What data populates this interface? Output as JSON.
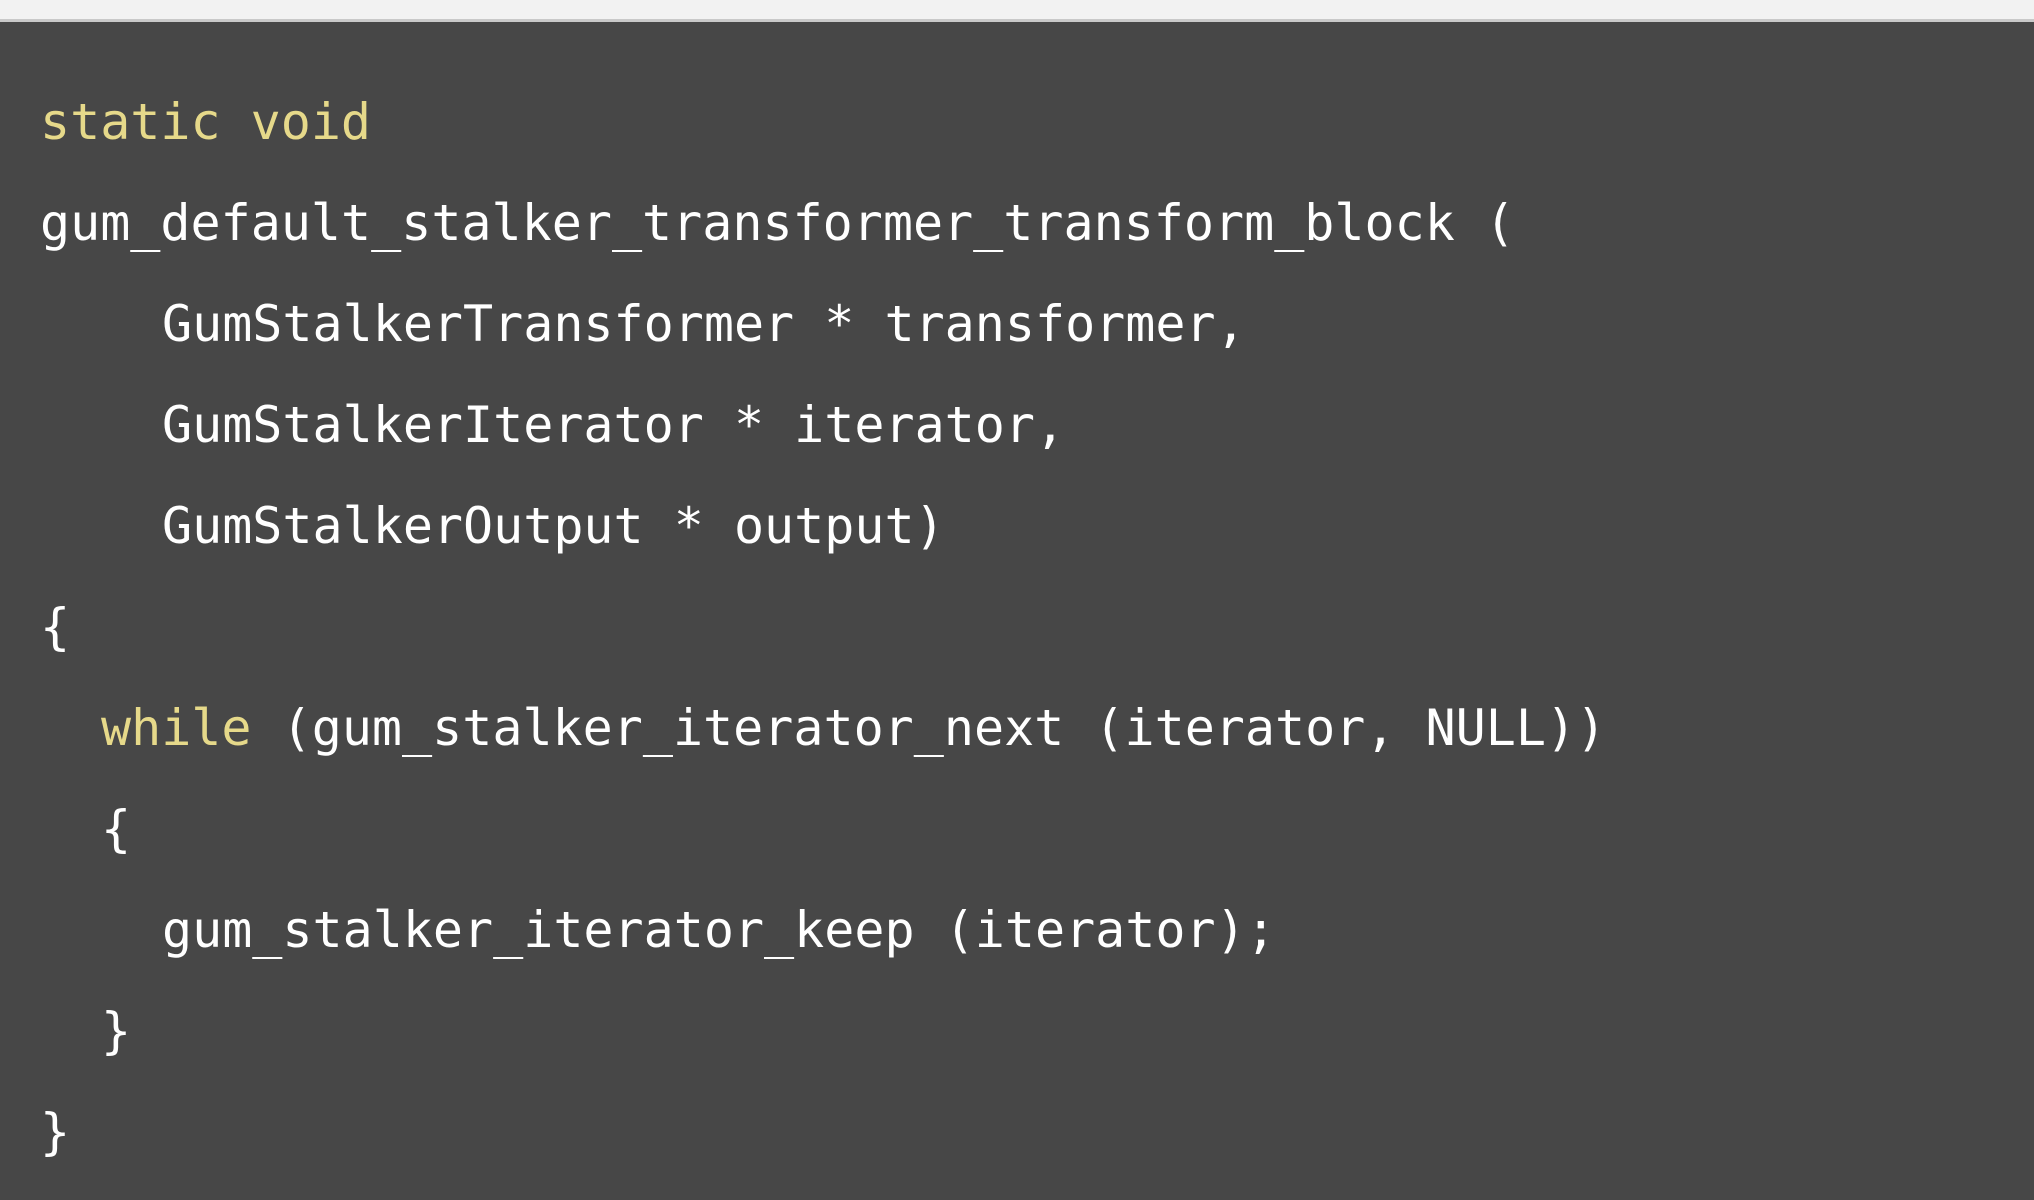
{
  "code": {
    "lines": [
      {
        "kw1": "static",
        "kw2": "void"
      },
      {
        "text": "gum_default_stalker_transformer_transform_block ("
      },
      {
        "text": "GumStalkerTransformer * transformer,"
      },
      {
        "text": "GumStalkerIterator * iterator,"
      },
      {
        "text": "GumStalkerOutput * output)"
      },
      {
        "text": "{"
      },
      {
        "kw": "while",
        "text": " (gum_stalker_iterator_next (iterator, NULL))"
      },
      {
        "text": "{"
      },
      {
        "text": "gum_stalker_iterator_keep (iterator);"
      },
      {
        "text": "}"
      },
      {
        "text": "}"
      }
    ]
  },
  "colors": {
    "background": "#474747",
    "keyword": "#e6d98a",
    "text": "#ffffff"
  }
}
